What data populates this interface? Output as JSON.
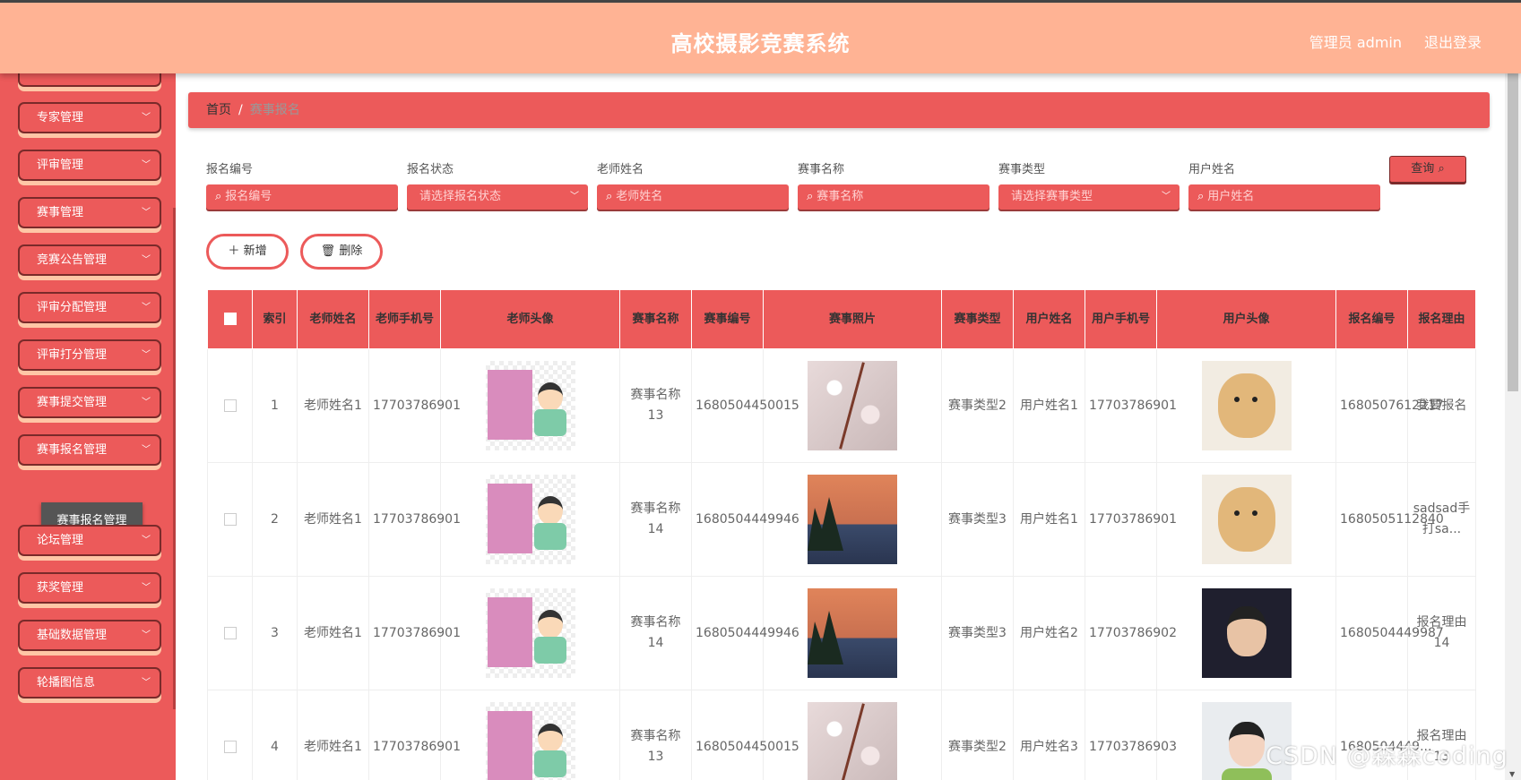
{
  "header": {
    "title": "高校摄影竞赛系统",
    "user": "管理员 admin",
    "logout": "退出登录"
  },
  "sidebar": {
    "items": [
      {
        "label": "专家管理"
      },
      {
        "label": "评审管理"
      },
      {
        "label": "赛事管理"
      },
      {
        "label": "竞赛公告管理"
      },
      {
        "label": "评审分配管理"
      },
      {
        "label": "评审打分管理"
      },
      {
        "label": "赛事提交管理"
      },
      {
        "label": "赛事报名管理"
      },
      {
        "label": "论坛管理"
      },
      {
        "label": "获奖管理"
      },
      {
        "label": "基础数据管理"
      },
      {
        "label": "轮播图信息"
      }
    ],
    "active_submenu": "赛事报名管理"
  },
  "breadcrumb": {
    "home": "首页",
    "separator": "/",
    "current": "赛事报名"
  },
  "filters": {
    "fields": [
      {
        "label": "报名编号",
        "placeholder": "报名编号"
      },
      {
        "label": "报名状态",
        "placeholder": "请选择报名状态"
      },
      {
        "label": "老师姓名",
        "placeholder": "老师姓名"
      },
      {
        "label": "赛事名称",
        "placeholder": "赛事名称"
      },
      {
        "label": "赛事类型",
        "placeholder": "请选择赛事类型"
      },
      {
        "label": "用户姓名",
        "placeholder": "用户姓名"
      }
    ],
    "query_label": "查询"
  },
  "actions": {
    "add_label": "新增",
    "delete_label": "删除"
  },
  "table": {
    "headers": [
      "索引",
      "老师姓名",
      "老师手机号",
      "老师头像",
      "赛事名称",
      "赛事编号",
      "赛事照片",
      "赛事类型",
      "用户姓名",
      "用户手机号",
      "用户头像",
      "报名编号",
      "报名理由"
    ],
    "rows": [
      {
        "index": "1",
        "teacher": "老师姓名1",
        "tphone": "17703786901",
        "contest": "赛事名称13",
        "cno": "1680504450015",
        "ctype": "赛事类型2",
        "user": "用户姓名1",
        "uphone": "17703786901",
        "regno": "1680507612217",
        "reason": "我要报名"
      },
      {
        "index": "2",
        "teacher": "老师姓名1",
        "tphone": "17703786901",
        "contest": "赛事名称14",
        "cno": "1680504449946",
        "ctype": "赛事类型3",
        "user": "用户姓名1",
        "uphone": "17703786901",
        "regno": "1680505112840",
        "reason": "sadsad手打sa..."
      },
      {
        "index": "3",
        "teacher": "老师姓名1",
        "tphone": "17703786901",
        "contest": "赛事名称14",
        "cno": "1680504449946",
        "ctype": "赛事类型3",
        "user": "用户姓名2",
        "uphone": "17703786902",
        "regno": "1680504449987",
        "reason": "报名理由14"
      },
      {
        "index": "4",
        "teacher": "老师姓名1",
        "tphone": "17703786901",
        "contest": "赛事名称13",
        "cno": "1680504450015",
        "ctype": "赛事类型2",
        "user": "用户姓名3",
        "uphone": "17703786903",
        "regno": "1680504449...",
        "reason": "报名理由13"
      }
    ]
  },
  "watermark": "CSDN @森森coding"
}
